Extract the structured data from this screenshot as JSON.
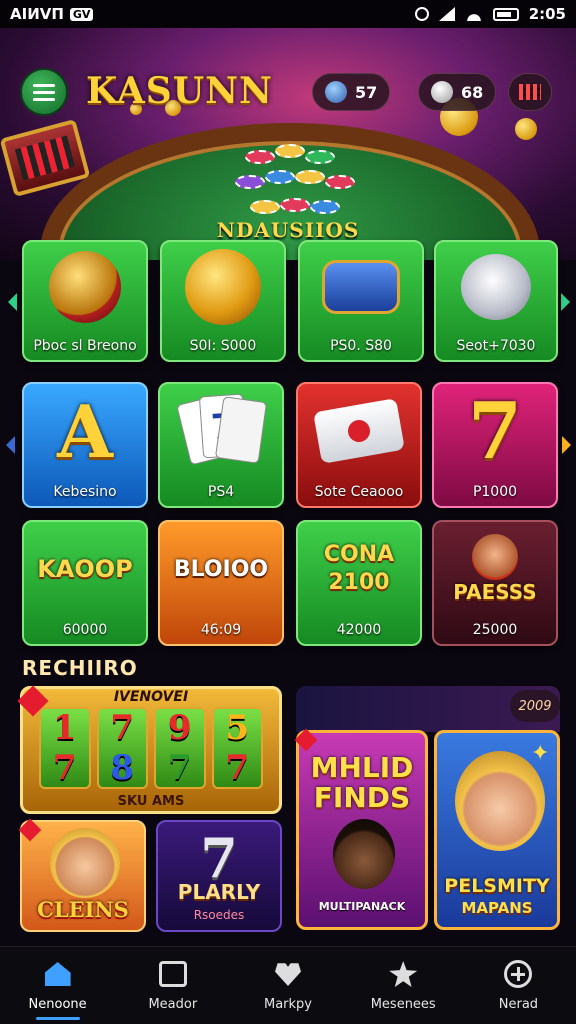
{
  "status_bar": {
    "carrier": "AIИVΠ",
    "app_badge": "GV",
    "time": "2:05"
  },
  "header": {
    "logo": "KASUNN",
    "balance_1": "57",
    "balance_2": "68",
    "hero_text": "NDAUSIIOS"
  },
  "featured": [
    {
      "label": "Pboc sl Breono",
      "icon": "vault-icon"
    },
    {
      "label": "S0I: S000",
      "icon": "gold-coin-icon"
    },
    {
      "label": "PS0. S80",
      "icon": "cannon-icon"
    },
    {
      "label": "Seot+7030",
      "icon": "robot-icon"
    }
  ],
  "games_row_1": [
    {
      "label": "Kebesino",
      "art": "A"
    },
    {
      "label": "PS4",
      "art": "cards"
    },
    {
      "label": "Sote Ceaooo",
      "art": "ticket"
    },
    {
      "label": "P1000",
      "art": "7"
    }
  ],
  "games_row_2": [
    {
      "label": "60000",
      "art": "KAOOP"
    },
    {
      "label": "46:09",
      "art": "BLOIOO"
    },
    {
      "label": "42000",
      "art": "CONA 2100"
    },
    {
      "label": "25000",
      "art": "PAESSS"
    }
  ],
  "section_title": "RECHIIRO",
  "promos": {
    "reels_title": "IVENOVEI",
    "reels_bottom": "SKU AMS",
    "reel_symbols": [
      [
        "1",
        "7"
      ],
      [
        "7",
        "8"
      ],
      [
        "9",
        "7"
      ],
      [
        "5",
        "7"
      ]
    ],
    "badge": "2009",
    "cleins": "CLEINS",
    "plarly_title": "PLARLY",
    "plarly_sub": "Rsoedes",
    "mhlid_title": "MHLID",
    "mhlid_sub": "FINDS",
    "mhlid_caption": "MULTIPANACK",
    "pelsmity_title": "PELSMITY",
    "pelsmity_sub": "MAPANS"
  },
  "bottom_nav": [
    {
      "label": "Nenoone",
      "icon": "home-icon",
      "active": true
    },
    {
      "label": "Meador",
      "icon": "box-icon",
      "active": false
    },
    {
      "label": "Markpy",
      "icon": "heart-icon",
      "active": false
    },
    {
      "label": "Mesenees",
      "icon": "star-icon",
      "active": false
    },
    {
      "label": "Nerad",
      "icon": "plus-icon",
      "active": false
    }
  ],
  "colors": {
    "accent": "#3fa0ff",
    "gold": "#ffd23a",
    "green": "#1f9a2e"
  }
}
